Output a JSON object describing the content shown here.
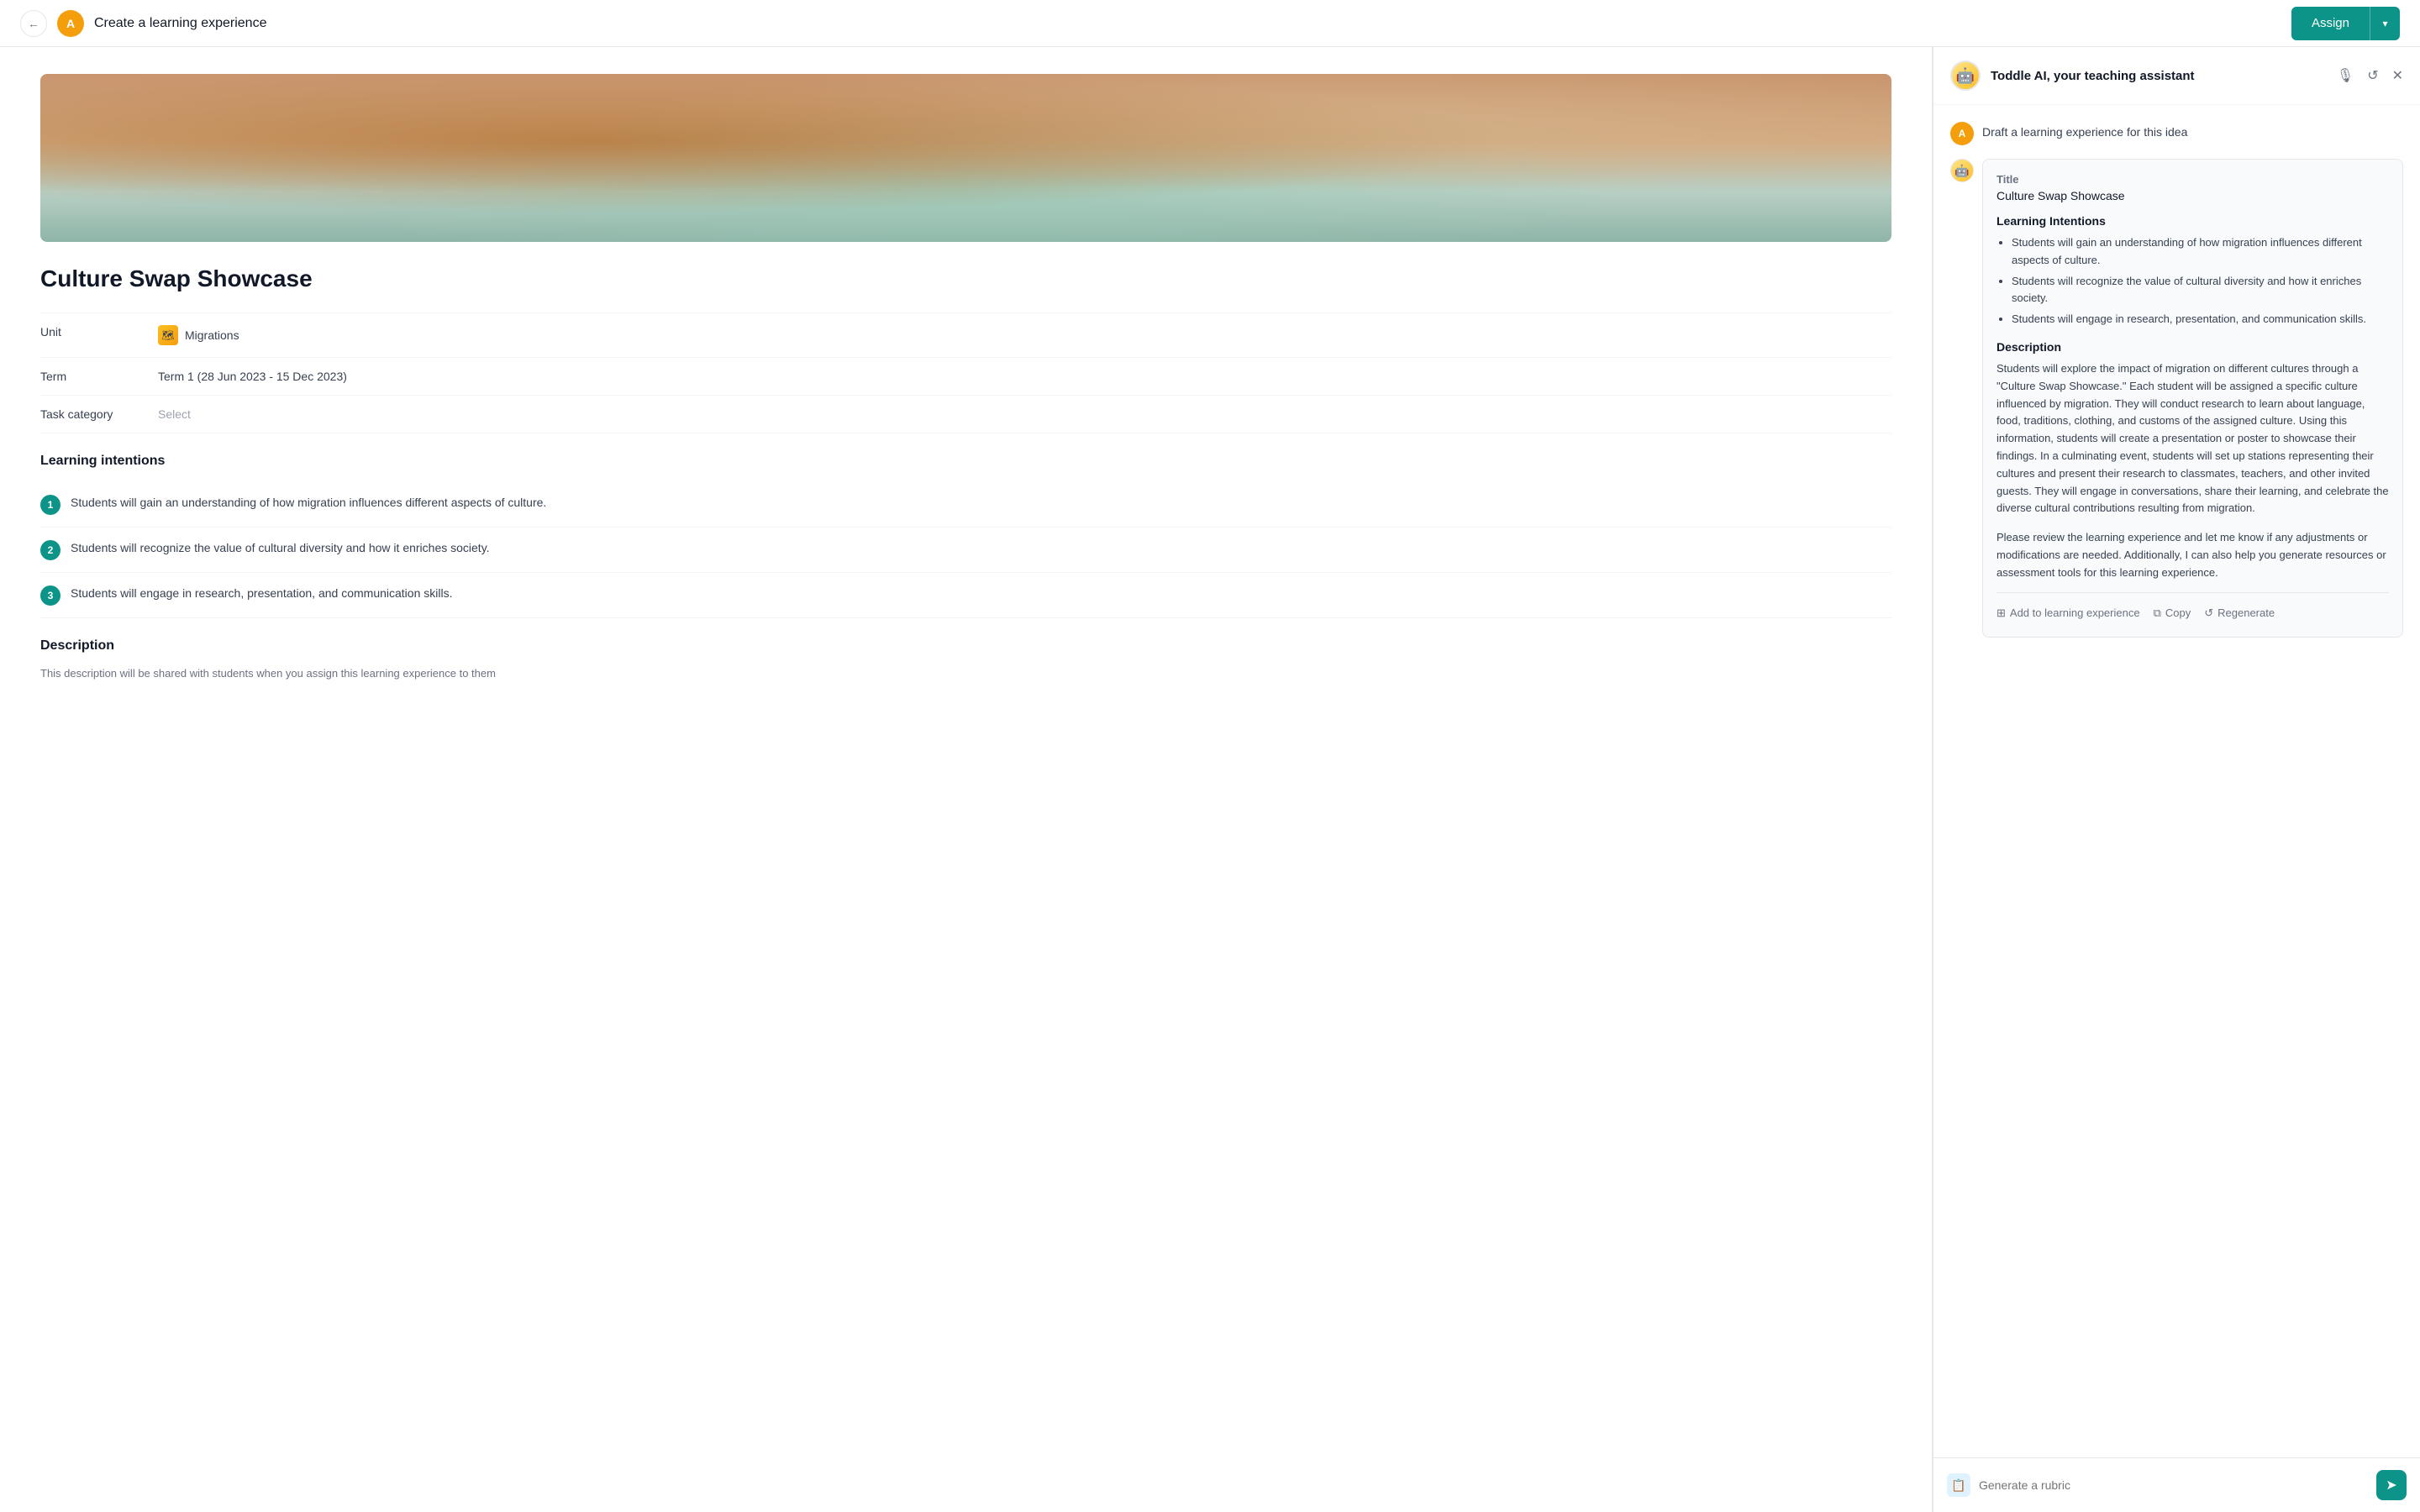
{
  "header": {
    "back_label": "←",
    "avatar_letter": "A",
    "page_title": "Create a learning experience",
    "assign_label": "Assign",
    "dropdown_label": "▾"
  },
  "left": {
    "experience_title": "Culture Swap Showcase",
    "meta": {
      "unit_label": "Unit",
      "unit_value": "Migrations",
      "term_label": "Term",
      "term_value": "Term 1 (28 Jun 2023 - 15 Dec 2023)",
      "task_category_label": "Task category",
      "task_category_placeholder": "Select"
    },
    "learning_intentions": {
      "section_label": "Learning intentions",
      "items": [
        "Students will gain an understanding of how migration influences different aspects of culture.",
        "Students will recognize the value of cultural diversity and how it enriches society.",
        "Students will engage in research, presentation, and communication skills."
      ]
    },
    "description": {
      "section_label": "Description",
      "subtitle": "This description will be shared with students when you assign this learning experience to them"
    }
  },
  "ai": {
    "header": {
      "name": "Toddle AI, your teaching assistant",
      "audio_icon": "🎙",
      "refresh_icon": "↺",
      "close_icon": "✕"
    },
    "user_message": {
      "avatar_letter": "A",
      "text": "Draft a learning experience for this idea"
    },
    "response": {
      "title_label": "Title",
      "title_value": "Culture Swap Showcase",
      "learning_intentions_heading": "Learning Intentions",
      "learning_intentions": [
        "Students will gain an understanding of how migration influences different aspects of culture.",
        "Students will recognize the value of cultural diversity and how it enriches society.",
        "Students will engage in research, presentation, and communication skills."
      ],
      "description_heading": "Description",
      "description_text": "Students will explore the impact of migration on different cultures through a \"Culture Swap Showcase.\" Each student will be assigned a specific culture influenced by migration. They will conduct research to learn about language, food, traditions, clothing, and customs of the assigned culture. Using this information, students will create a presentation or poster to showcase their findings. In a culminating event, students will set up stations representing their cultures and present their research to classmates, teachers, and other invited guests. They will engage in conversations, share their learning, and celebrate the diverse cultural contributions resulting from migration.",
      "closing_text": "Please review the learning experience and let me know if any adjustments or modifications are needed. Additionally, I can also help you generate resources or assessment tools for this learning experience.",
      "actions": {
        "add_label": "Add to learning experience",
        "copy_label": "Copy",
        "regenerate_label": "Regenerate"
      }
    },
    "input": {
      "placeholder": "Generate a rubric",
      "send_icon": "➤"
    }
  }
}
